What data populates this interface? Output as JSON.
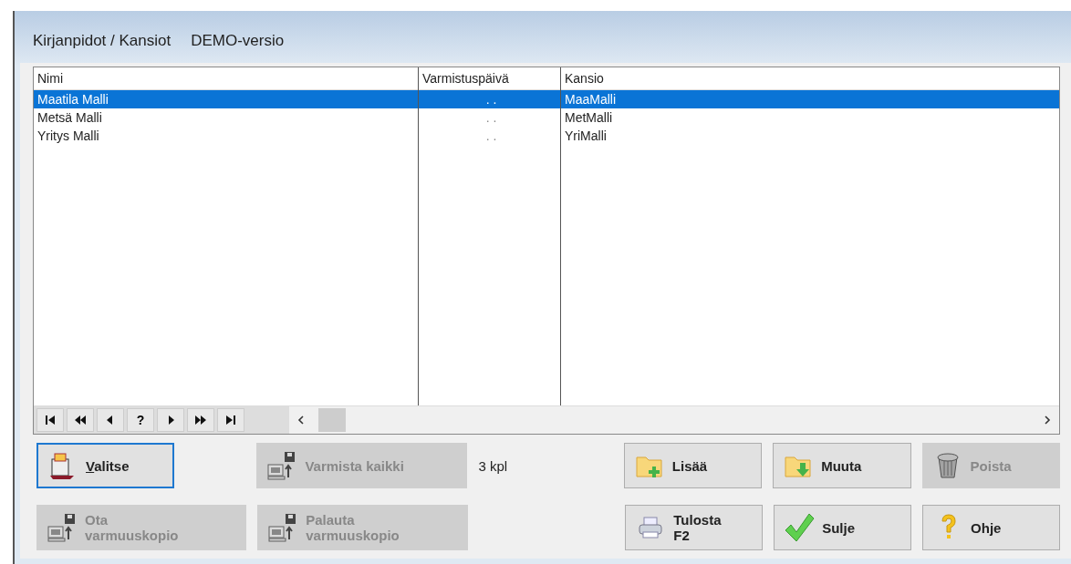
{
  "window": {
    "title": "Kirjanpidot / Kansiot",
    "subtitle": "DEMO-versio"
  },
  "table": {
    "columns": [
      "Nimi",
      "Varmistuspäivä",
      "Kansio"
    ],
    "rows": [
      {
        "cells": [
          "Maatila Malli",
          ". .",
          "MaaMalli"
        ],
        "selected": true
      },
      {
        "cells": [
          "Metsä Malli",
          ". .",
          "MetMalli"
        ],
        "selected": false
      },
      {
        "cells": [
          "Yritys Malli",
          ". .",
          "YriMalli"
        ],
        "selected": false
      }
    ]
  },
  "navigator": [
    {
      "kind": "first"
    },
    {
      "kind": "prev-page"
    },
    {
      "kind": "prev"
    },
    {
      "kind": "find",
      "label": "?"
    },
    {
      "kind": "next"
    },
    {
      "kind": "next-page"
    },
    {
      "kind": "last"
    }
  ],
  "count": "3 kpl",
  "buttons_row_1": [
    {
      "kind": "select",
      "label": "Valitse",
      "disabled": false,
      "focused": true
    },
    {
      "kind": "backup-all",
      "label": "Varmista kaikki",
      "disabled": true,
      "focused": false
    },
    {
      "kind": "count"
    },
    {
      "kind": "add",
      "label": "Lisää",
      "disabled": false,
      "focused": false
    },
    {
      "kind": "edit",
      "label": "Muuta",
      "disabled": false,
      "focused": false
    },
    {
      "kind": "delete",
      "label": "Poista",
      "disabled": true,
      "focused": false
    }
  ],
  "buttons_row_2": [
    {
      "kind": "backup",
      "label": "Ota varmuuskopio",
      "disabled": true,
      "focused": false
    },
    {
      "kind": "restore",
      "label": "Palauta varmuuskopio",
      "disabled": true,
      "focused": false
    },
    {
      "kind": "spacer"
    },
    {
      "kind": "print",
      "label": "Tulosta F2",
      "disabled": false,
      "focused": false
    },
    {
      "kind": "close",
      "label": "Sulje",
      "disabled": false,
      "focused": false
    },
    {
      "kind": "help",
      "label": "Ohje",
      "disabled": false,
      "focused": false
    }
  ]
}
